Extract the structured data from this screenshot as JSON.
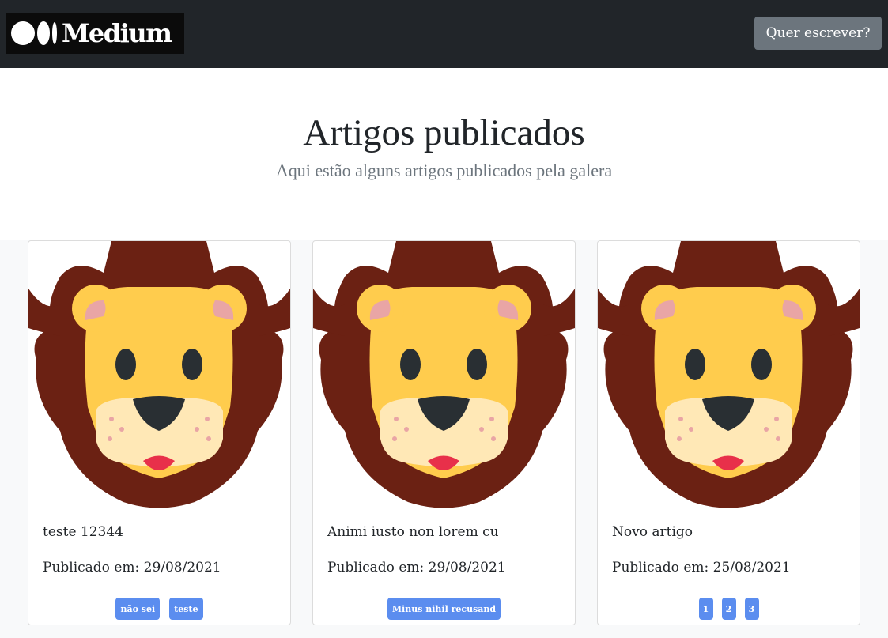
{
  "header": {
    "logo_text": "Medium",
    "write_button_label": "Quer escrever?"
  },
  "hero": {
    "title": "Artigos publicados",
    "subtitle": "Aqui estão alguns artigos publicados pela galera"
  },
  "articles": [
    {
      "image_icon": "lion-face-icon",
      "title": "teste 12344",
      "published": "Publicado em: 29/08/2021",
      "tags": [
        "não sei",
        "teste"
      ]
    },
    {
      "image_icon": "lion-face-icon",
      "title": "Animi iusto non lorem cu",
      "published": "Publicado em: 29/08/2021",
      "tags": [
        "Minus nihil recusand"
      ]
    },
    {
      "image_icon": "lion-face-icon",
      "title": "Novo artigo",
      "published": "Publicado em: 25/08/2021",
      "tags": [
        "1",
        "2",
        "3"
      ]
    }
  ],
  "colors": {
    "navbar": "#212529",
    "button": "#6c757d",
    "tag": "#5b8def",
    "album_bg": "#f8f9fa"
  }
}
